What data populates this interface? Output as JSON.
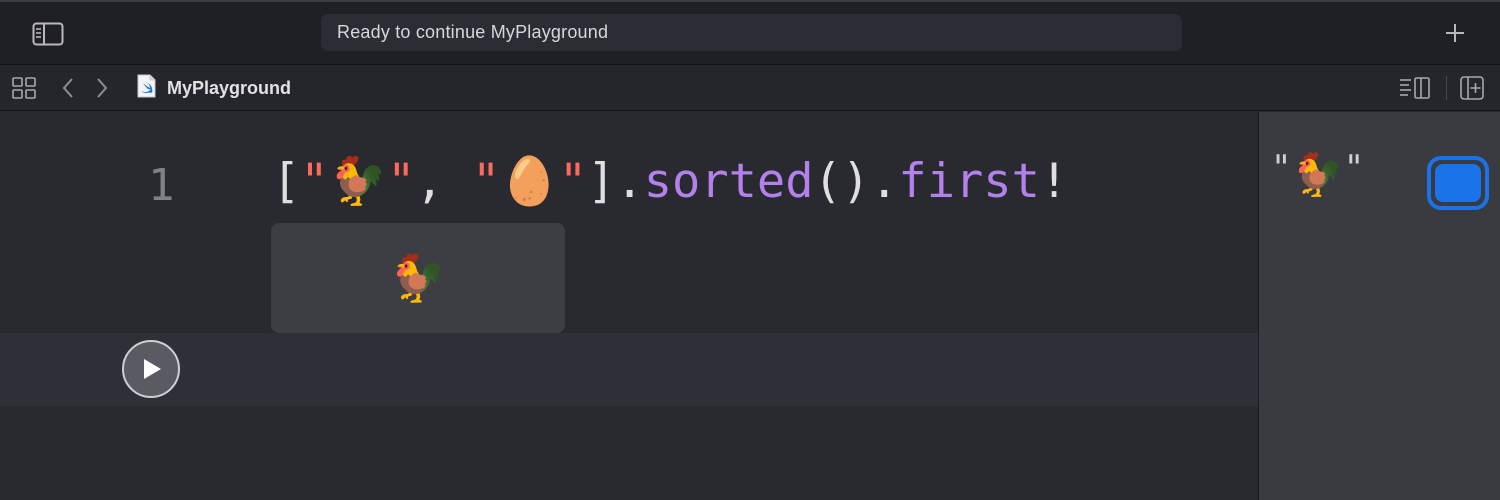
{
  "window": {
    "status_text": "Ready to continue MyPlayground"
  },
  "navbar": {
    "file_name": "MyPlayground"
  },
  "editor": {
    "line_number": "1",
    "code": {
      "open_bracket": "[",
      "string1_open": "\"",
      "string1_emoji": "🐓",
      "string1_close": "\"",
      "comma": ", ",
      "string2_open": "\"",
      "string2_emoji": "🥚",
      "string2_close": "\"",
      "close_bracket": "]",
      "dot1": ".",
      "method": "sorted",
      "parens": "()",
      "dot2": ".",
      "property": "first",
      "bang": "!"
    },
    "inline_result": "🐓"
  },
  "results": {
    "quote_open": "\"",
    "value": "🐓",
    "quote_close": "\""
  },
  "icons": {
    "sidebar": "sidebar-toggle-icon",
    "add": "plus-icon",
    "grid": "related-items-grid-icon",
    "back": "chevron-left-icon",
    "forward": "chevron-right-icon",
    "file": "swift-file-icon",
    "editor_options": "editor-options-icon",
    "add_editor": "add-editor-icon",
    "play": "play-icon",
    "quicklook": "quick-look-icon"
  },
  "colors": {
    "string": "#fc6a5d",
    "method": "#b281eb",
    "accent": "#1a73e8"
  }
}
